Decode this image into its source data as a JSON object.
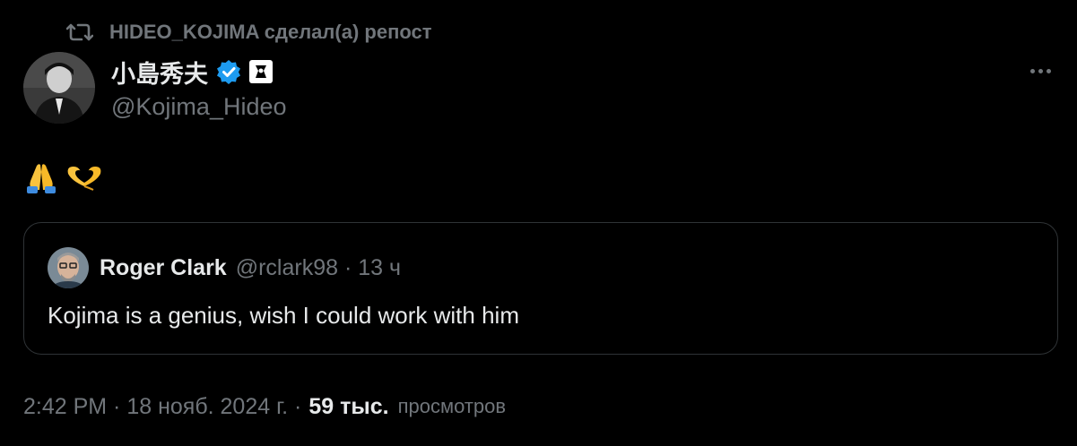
{
  "repost": {
    "icon": "repost-icon",
    "text": "HIDEO_KOJIMA сделал(а) репост"
  },
  "tweet": {
    "author": {
      "display_name": "小島秀夫",
      "handle": "@Kojima_Hideo",
      "verified_icon": "verified-badge-icon",
      "affiliate_icon": "affiliate-badge-icon"
    },
    "more_icon": "more-options-icon",
    "body_emojis": [
      "folded-hands-emoji",
      "heart-hands-emoji"
    ],
    "quote": {
      "author_name": "Roger Clark",
      "meta": "@rclark98 · 13 ч",
      "text": "Kojima is a genius, wish I could work with him"
    },
    "footer": {
      "timestamp": "2:42 PM · 18 нояб. 2024 г. ·",
      "views_count": "59 тыс.",
      "views_label": "просмотров"
    }
  },
  "colors": {
    "background": "#000000",
    "primary_text": "#e7e9ea",
    "secondary_text": "#71767b",
    "verified_blue": "#1d9bf0",
    "border": "#2f3336"
  }
}
